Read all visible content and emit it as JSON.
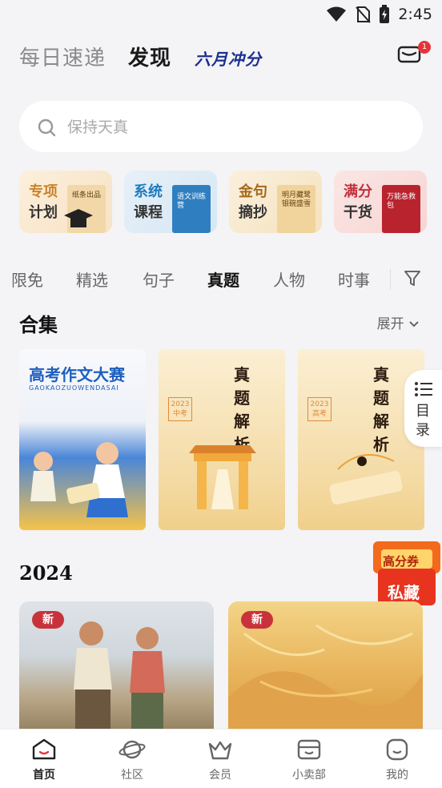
{
  "status_bar": {
    "time": "2:45"
  },
  "header": {
    "tabs": [
      "每日速递",
      "发现"
    ],
    "active_tab": "发现",
    "brand": "六月冲分",
    "mail_badge": "1"
  },
  "search": {
    "placeholder": "保持天真"
  },
  "categories": [
    {
      "line1": "专项",
      "line2": "计划",
      "book": "纸条出品",
      "accent": "#c9842a"
    },
    {
      "line1": "系统",
      "line2": "课程",
      "book": "语文训练营",
      "accent": "#1f7bbd"
    },
    {
      "line1": "金句",
      "line2": "摘抄",
      "book": "明月藏鹭 银碗盛雪",
      "accent": "#a36a1a"
    },
    {
      "line1": "满分",
      "line2": "干货",
      "book": "万能急救包",
      "accent": "#c0303a"
    }
  ],
  "filter_tabs": [
    "限免",
    "精选",
    "句子",
    "真题",
    "人物",
    "时事"
  ],
  "active_filter": "真题",
  "collection": {
    "title": "合集",
    "expand": "展开",
    "covers": [
      {
        "title": "高考作文大赛",
        "subtitle": "GAOKAOZUOWENDASAI"
      },
      {
        "title": "真题解析",
        "year": "2023 中考"
      },
      {
        "title": "真题解析",
        "year": "2023 高考"
      }
    ]
  },
  "toc": {
    "label": "目录"
  },
  "promo": {
    "line1": "高分券",
    "line2": "私藏"
  },
  "year_section": {
    "title": "2024",
    "cards": [
      {
        "tag": "新"
      },
      {
        "tag": "新"
      }
    ]
  },
  "bottom_nav": [
    {
      "label": "首页",
      "icon": "home-icon"
    },
    {
      "label": "社区",
      "icon": "planet-icon"
    },
    {
      "label": "会员",
      "icon": "crown-icon"
    },
    {
      "label": "小卖部",
      "icon": "shop-icon"
    },
    {
      "label": "我的",
      "icon": "profile-icon"
    }
  ],
  "colors": {
    "accent": "#c8333b",
    "brand_blue": "#1b2f8f",
    "brand_orange": "#f06a10"
  }
}
